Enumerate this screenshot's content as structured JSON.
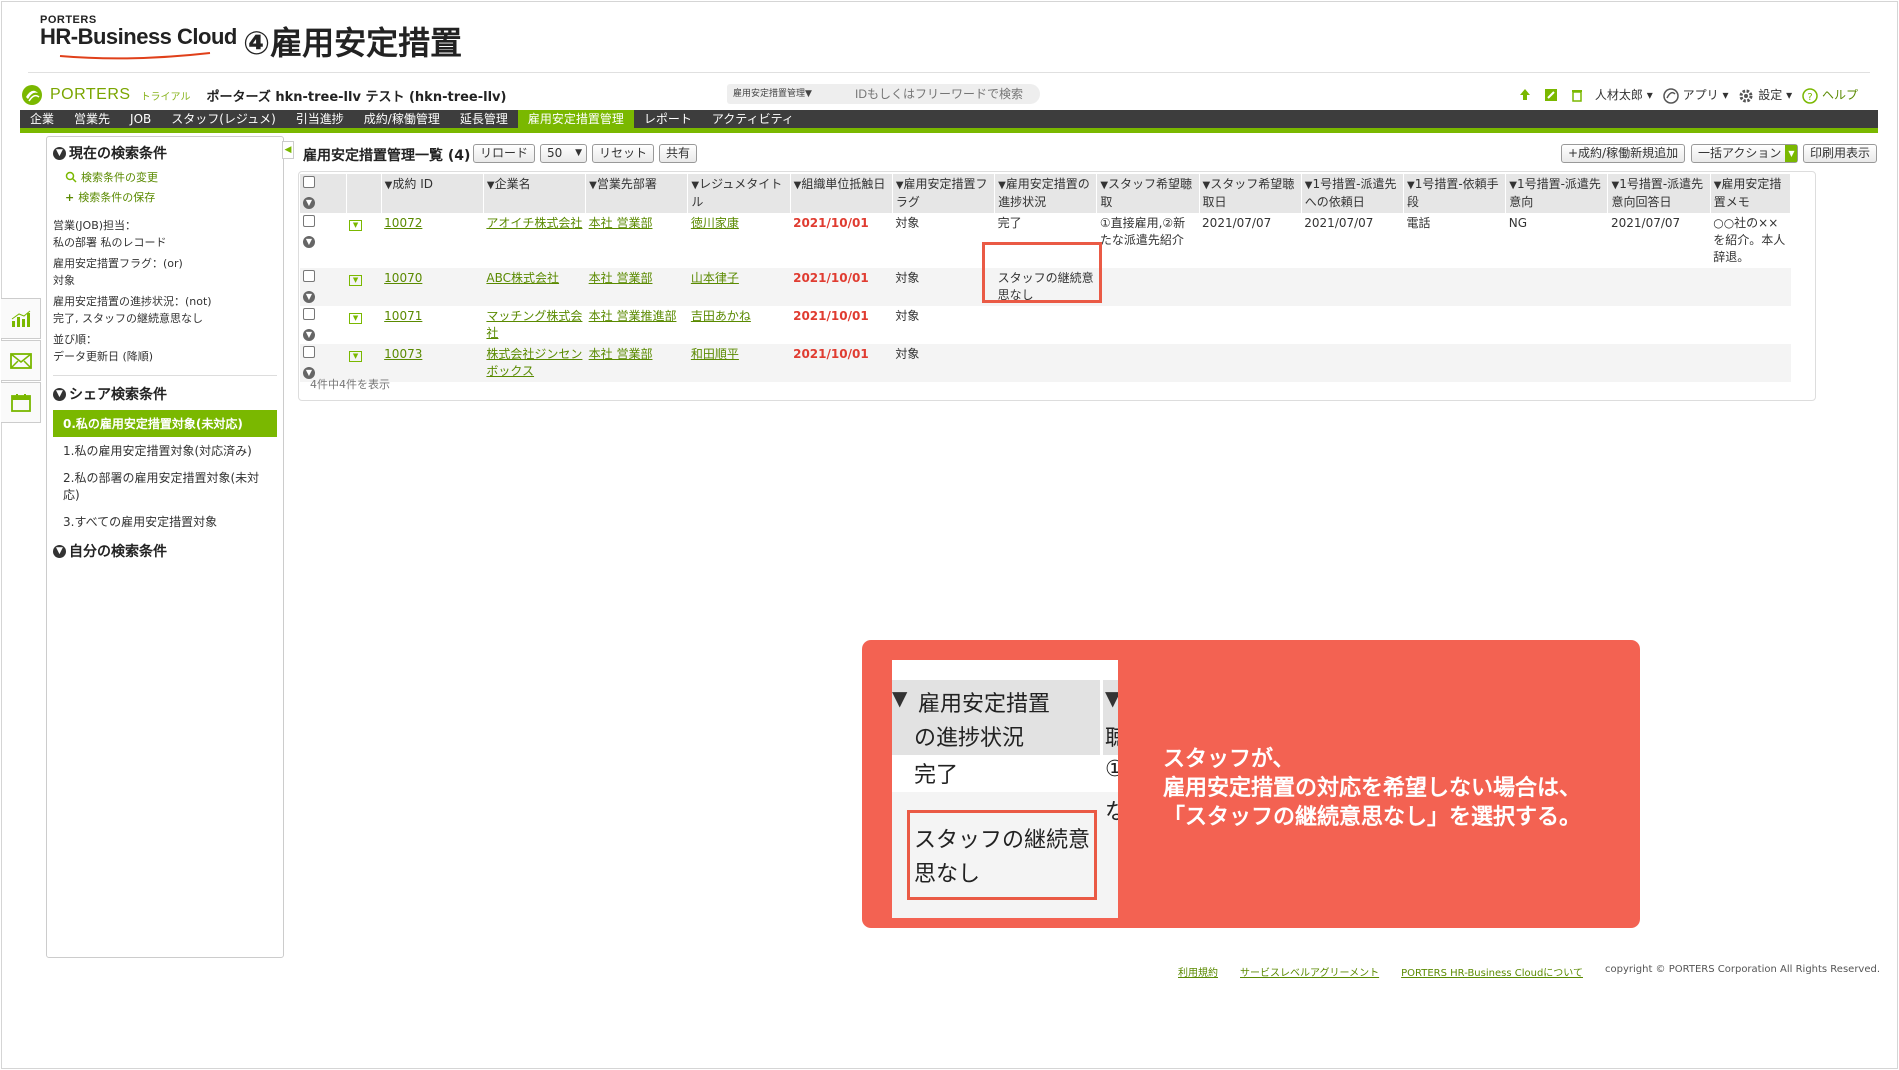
{
  "slide": {
    "logo_small": "PORTERS",
    "logo_big": "HR-Business Cloud",
    "title": "④雇用安定措置"
  },
  "app": {
    "brand": "PORTERS",
    "trial": "トライアル",
    "company": "ポーターズ hkn-tree-llv テスト (hkn-tree-llv)",
    "search_scope": "雇用安定措置管理▼",
    "search_placeholder": "IDもしくはフリーワードで検索",
    "user": "人材太郎",
    "apps": "アプリ",
    "settings": "設定",
    "help": "ヘルプ"
  },
  "nav": {
    "items": [
      "企業",
      "営業先",
      "JOB",
      "スタッフ(レジュメ)",
      "引当進捗",
      "成約/稼働管理",
      "延長管理",
      "雇用安定措置管理",
      "レポート",
      "アクティビティ"
    ],
    "active_index": 7
  },
  "sidebar": {
    "current_title": "現在の検索条件",
    "change_link": "検索条件の変更",
    "save_link": "検索条件の保存",
    "conditions": [
      "営業(JOB)担当：\n私の部署 私のレコード",
      "雇用安定措置フラグ：(or)\n対象",
      "雇用安定措置の進捗状況：(not)\n完了, スタッフの継続意思なし",
      "並び順：\nデータ更新日 (降順)"
    ],
    "share_title": "シェア検索条件",
    "share_items": [
      "0.私の雇用安定措置対象(未対応)",
      "1.私の雇用安定措置対象(対応済み)",
      "2.私の部署の雇用安定措置対象(未対応)",
      "3.すべての雇用安定措置対象"
    ],
    "own_title": "自分の検索条件"
  },
  "list": {
    "title": "雇用安定措置管理一覧 (4)",
    "reload": "リロード",
    "per_page": "50",
    "reset": "リセット",
    "share": "共有",
    "add_new": "+成約/稼働新規追加",
    "bulk_action": "一括アクション",
    "print": "印刷用表示",
    "count_text": "4件中4件を表示",
    "columns": [
      "成約 ID",
      "企業名",
      "営業先部署",
      "レジュメタイトル",
      "組織単位抵触日",
      "雇用安定措置フラグ",
      "雇用安定措置の進捗状況",
      "スタッフ希望聴取",
      "スタッフ希望聴取日",
      "1号措置-派遣先への依頼日",
      "1号措置-依頼手段",
      "1号措置-派遣先意向",
      "1号措置-派遣先意向回答日",
      "雇用安定措置メモ"
    ],
    "rows": [
      [
        "10072",
        "アオイチ株式会社",
        "本社 営業部",
        "徳川家康",
        "2021/10/01",
        "対象",
        "完了",
        "①直接雇用,②新たな派遣先紹介",
        "2021/07/07",
        "2021/07/07",
        "電話",
        "NG",
        "2021/07/07",
        "○○社の××を紹介。本人辞退。"
      ],
      [
        "10070",
        "ABC株式会社",
        "本社 営業部",
        "山本律子",
        "2021/10/01",
        "対象",
        "スタッフの継続意思なし",
        "",
        "",
        "",
        "",
        "",
        "",
        ""
      ],
      [
        "10071",
        "マッチング株式会社",
        "本社 営業推進部",
        "吉田あかね",
        "2021/10/01",
        "対象",
        "",
        "",
        "",
        "",
        "",
        "",
        "",
        ""
      ],
      [
        "10073",
        "株式会社ジンセンボックス",
        "本社 営業部",
        "和田順平",
        "2021/10/01",
        "対象",
        "",
        "",
        "",
        "",
        "",
        "",
        "",
        ""
      ]
    ]
  },
  "callout": {
    "zoom_header_line1": "雇用安定措置",
    "zoom_header_line2": "の進捗状況",
    "zoom_next_col_head": "聴",
    "zoom_next_col_r1": "①",
    "zoom_next_col_r1b": "な",
    "zoom_row1": "完了",
    "zoom_row2_line1": "スタッフの継続意",
    "zoom_row2_line2": "思なし",
    "text_line1": "スタッフが、",
    "text_line2": "雇用安定措置の対応を希望しない場合は、",
    "text_line3": "「スタッフの継続意思なし」を選択する。"
  },
  "footer": {
    "terms": "利用規約",
    "sla": "サービスレベルアグリーメント",
    "about": "PORTERS HR-Business Cloudについて",
    "copyright": "copyright © PORTERS Corporation All Rights Reserved."
  },
  "colors": {
    "accent_green": "#7ab800",
    "nav_dark": "#3d3d3d",
    "callout_red": "#f36252",
    "highlight_red": "#ea5a45",
    "date_red": "#e03c31"
  }
}
